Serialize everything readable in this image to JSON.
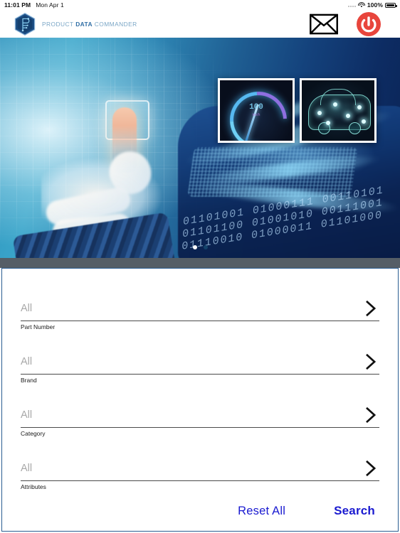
{
  "status_bar": {
    "time": "11:01 PM",
    "date": "Mon Apr 1",
    "battery_percent": "100%",
    "wifi_icon": "wifi-icon",
    "battery_icon": "battery-full-icon",
    "signal_icon": "signal-dots-icon"
  },
  "header": {
    "logo_icon": "hexagon-p-logo-icon",
    "brand_part1": "PRODUCT ",
    "brand_bold": "DATA",
    "brand_part2": " COMMANDER",
    "mail_icon": "envelope-icon",
    "power_icon": "power-button-icon"
  },
  "banner": {
    "main_image_alt": "hand-touching-circuit-chip",
    "thumbnails": [
      {
        "name": "speedometer-gauge-thumbnail",
        "gauge_value": "100",
        "gauge_unit": "km/h"
      },
      {
        "name": "wireframe-car-thumbnail"
      }
    ],
    "page_dots": [
      {
        "state": "active"
      },
      {
        "state": "inactive"
      }
    ],
    "colors": {
      "accent_blue": "#2a5d91",
      "deep_blue": "#0b2252",
      "cyan": "#39a4c9"
    }
  },
  "search_form": {
    "fields": [
      {
        "value": "All",
        "label": "Part Number",
        "chevron": "chevron-right-icon"
      },
      {
        "value": "All",
        "label": "Brand",
        "chevron": "chevron-right-icon"
      },
      {
        "value": "All",
        "label": "Category",
        "chevron": "chevron-right-icon"
      },
      {
        "value": "All",
        "label": "Attributes",
        "chevron": "chevron-right-icon"
      }
    ],
    "reset_label": "Reset All",
    "search_label": "Search",
    "link_color": "#1a1ad0"
  }
}
